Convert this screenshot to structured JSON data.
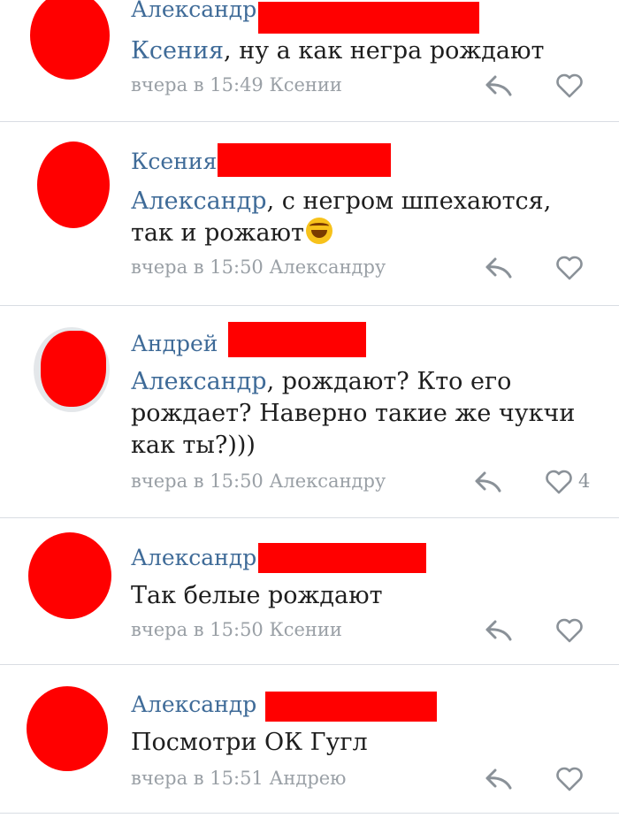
{
  "comments": [
    {
      "author": "Александр",
      "mention": "Ксения",
      "text": ", ну а как негра рождают",
      "time": "вчера в 15:49",
      "reply_to": "Ксении",
      "likes": ""
    },
    {
      "author": "Ксения",
      "mention": "Александр",
      "text": ", с негром шпехаются, так и рожают",
      "time": "вчера в 15:50",
      "reply_to": "Александру",
      "likes": ""
    },
    {
      "author": "Андрей",
      "mention": "Александр",
      "text": ", рождают? Кто его рождает? Наверно такие же чукчи как ты?)))",
      "time": "вчера в 15:50",
      "reply_to": "Александру",
      "likes": "4"
    },
    {
      "author": "Александр",
      "mention": "",
      "text": "Так белые рождают",
      "time": "вчера в 15:50",
      "reply_to": "Ксении",
      "likes": ""
    },
    {
      "author": "Александр",
      "mention": "",
      "text": "Посмотри ОК Гугл",
      "time": "вчера в 15:51",
      "reply_to": "Андрею",
      "likes": ""
    }
  ],
  "colors": {
    "link": "#3f6b98",
    "redaction": "#ff0000",
    "meta": "#9aa0a6",
    "divider": "#d9dde3"
  },
  "icons": [
    "reply-icon",
    "heart-icon",
    "laughing-emoji-icon"
  ]
}
